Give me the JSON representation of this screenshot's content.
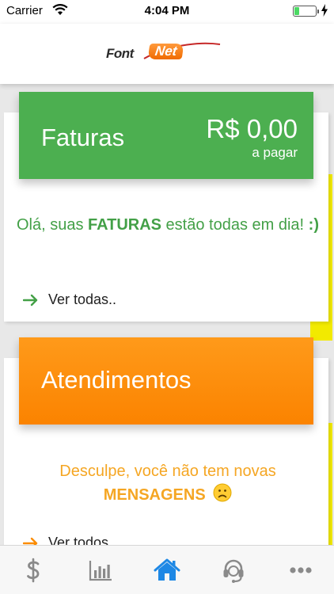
{
  "status": {
    "carrier": "Carrier",
    "time": "4:04 PM",
    "battery_level": 0.25
  },
  "brand": {
    "logo_left": "Font",
    "logo_right": "Net",
    "colors": {
      "green": "#4caf50",
      "orange": "#fb8c00",
      "yellow": "#f2ea00"
    }
  },
  "invoices": {
    "title": "Faturas",
    "amount": "R$ 0,00",
    "amount_caption": "a pagar",
    "message_pre": "Olá, suas ",
    "message_strong": "FATURAS",
    "message_post": " estão todas em dia! ",
    "message_emoticon": ":)",
    "see_all": "Ver todas.."
  },
  "support": {
    "title": "Atendimentos",
    "message_pre": "Desculpe, você não tem novas",
    "message_strong": "MENSAGENS",
    "emoji_icon": "frowning-face-icon",
    "see_all": "Ver todos"
  },
  "tabs": [
    {
      "icon": "dollar-icon",
      "active": false
    },
    {
      "icon": "bar-chart-icon",
      "active": false
    },
    {
      "icon": "home-icon",
      "active": true
    },
    {
      "icon": "headset-icon",
      "active": false
    },
    {
      "icon": "more-icon",
      "active": false
    }
  ]
}
